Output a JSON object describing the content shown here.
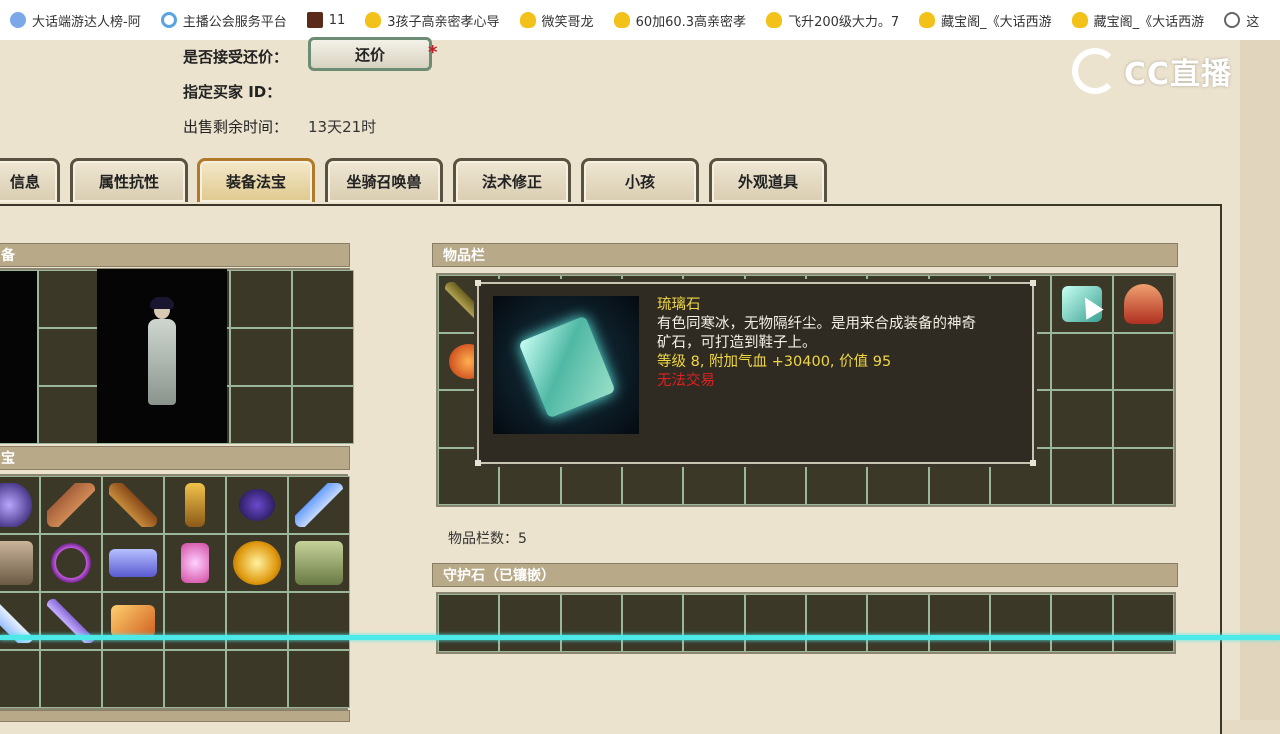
{
  "bookmarks": [
    {
      "icon": "blue-circle-icon",
      "label": "大话端游达人榜-阿"
    },
    {
      "icon": "ring-icon",
      "label": "主播公会服务平台"
    },
    {
      "icon": "game-icon",
      "label": "11"
    },
    {
      "icon": "duck-icon",
      "label": "3孩子高亲密孝心导"
    },
    {
      "icon": "duck-icon",
      "label": "微笑哥龙"
    },
    {
      "icon": "duck-icon",
      "label": "60加60.3高亲密孝"
    },
    {
      "icon": "duck-icon",
      "label": "飞升200级大力。7"
    },
    {
      "icon": "duck-icon",
      "label": "藏宝阁_《大话西游"
    },
    {
      "icon": "duck-icon",
      "label": "藏宝阁_《大话西游"
    },
    {
      "icon": "globe-icon",
      "label": "这"
    }
  ],
  "listing": {
    "accept_counter_label": "是否接受还价：",
    "counter_button": "还价",
    "buyer_id_label": "指定买家 ID：",
    "time_left_label": "出售剩余时间：",
    "time_left_value": "13天21时"
  },
  "logo": {
    "text": "CC直播"
  },
  "tabs": [
    {
      "label": "信息"
    },
    {
      "label": "属性抗性"
    },
    {
      "label": "装备法宝",
      "active": true
    },
    {
      "label": "坐骑召唤兽"
    },
    {
      "label": "法术修正"
    },
    {
      "label": "小孩"
    },
    {
      "label": "外观道具"
    }
  ],
  "panels": {
    "equipment": "备",
    "treasure": "宝",
    "inventory": "物品栏",
    "guard_stone": "守护石（已镶嵌）",
    "bottom_cut": "…"
  },
  "inventory_count": "物品栏数：5",
  "tooltip": {
    "name": "琉璃石",
    "desc_line1": "有色同寒冰，无物隔纤尘。是用来合成装备的神奇",
    "desc_line2": "矿石，可打造到鞋子上。",
    "stats": "等级 8, 附加气血 +30400, 价值 95",
    "trade": "无法交易"
  },
  "colors": {
    "panel_header": "#b8a988",
    "grid_bg": "#3b3828",
    "grid_line": "#9bb79a",
    "tooltip_name": "#f0d743",
    "tooltip_warning": "#e02020",
    "scanline": "#4de9e9"
  }
}
